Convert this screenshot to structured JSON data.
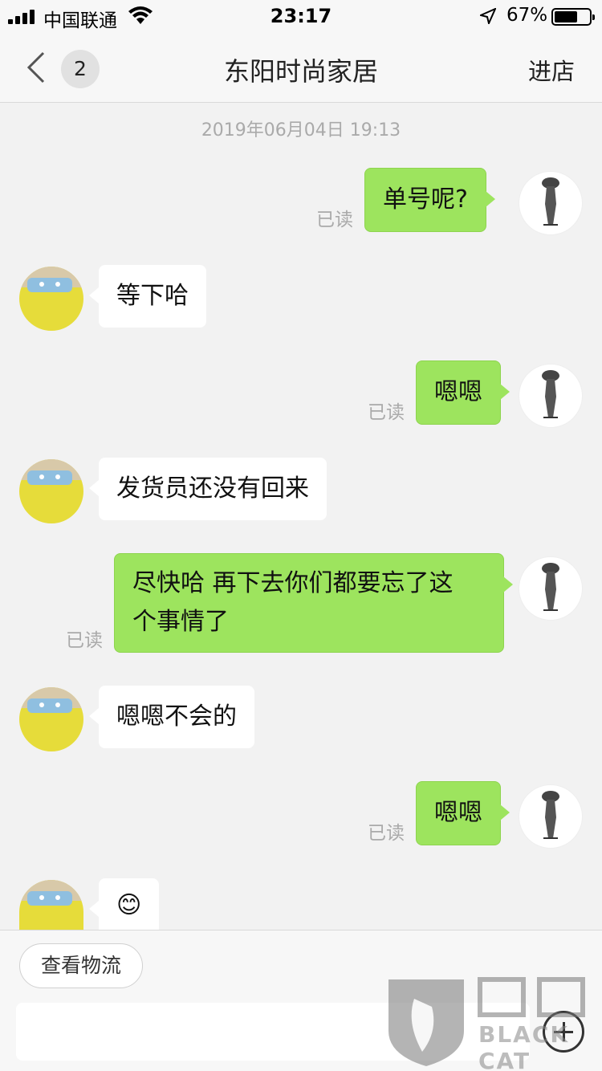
{
  "status_bar": {
    "carrier": "中国联通",
    "time": "23:17",
    "battery_percent": "67%",
    "battery_level": 0.67,
    "icons": [
      "signal-icon",
      "wifi-icon",
      "location-arrow-icon",
      "battery-icon"
    ]
  },
  "header": {
    "back_badge": "2",
    "title": "东阳时尚家居",
    "enter_store": "进店"
  },
  "chat": {
    "timestamp": "2019年06月04日 19:13",
    "read_label": "已读",
    "messages": [
      {
        "from": "me",
        "text": "单号呢?",
        "read": true
      },
      {
        "from": "shop",
        "text": "等下哈"
      },
      {
        "from": "me",
        "text": "嗯嗯",
        "read": true
      },
      {
        "from": "shop",
        "text": "发货员还没有回来"
      },
      {
        "from": "me",
        "text": "尽快哈  再下去你们都要忘了这个事情了",
        "line1": "尽快哈  再下去你们都要忘了这",
        "line2": "个事情了",
        "read": true
      },
      {
        "from": "shop",
        "text": "嗯嗯不会的"
      },
      {
        "from": "me",
        "text": "嗯嗯",
        "read": true
      },
      {
        "from": "shop",
        "text": "😊"
      }
    ]
  },
  "bottom": {
    "logistics_button": "查看物流",
    "input_value": "",
    "plus_icon": "plus-icon"
  },
  "watermark": {
    "logo_text": "黑猫",
    "brand": "BLACK CAT"
  },
  "colors": {
    "outgoing_bubble": "#9de45e",
    "incoming_bubble": "#ffffff",
    "background": "#f2f2f2"
  }
}
